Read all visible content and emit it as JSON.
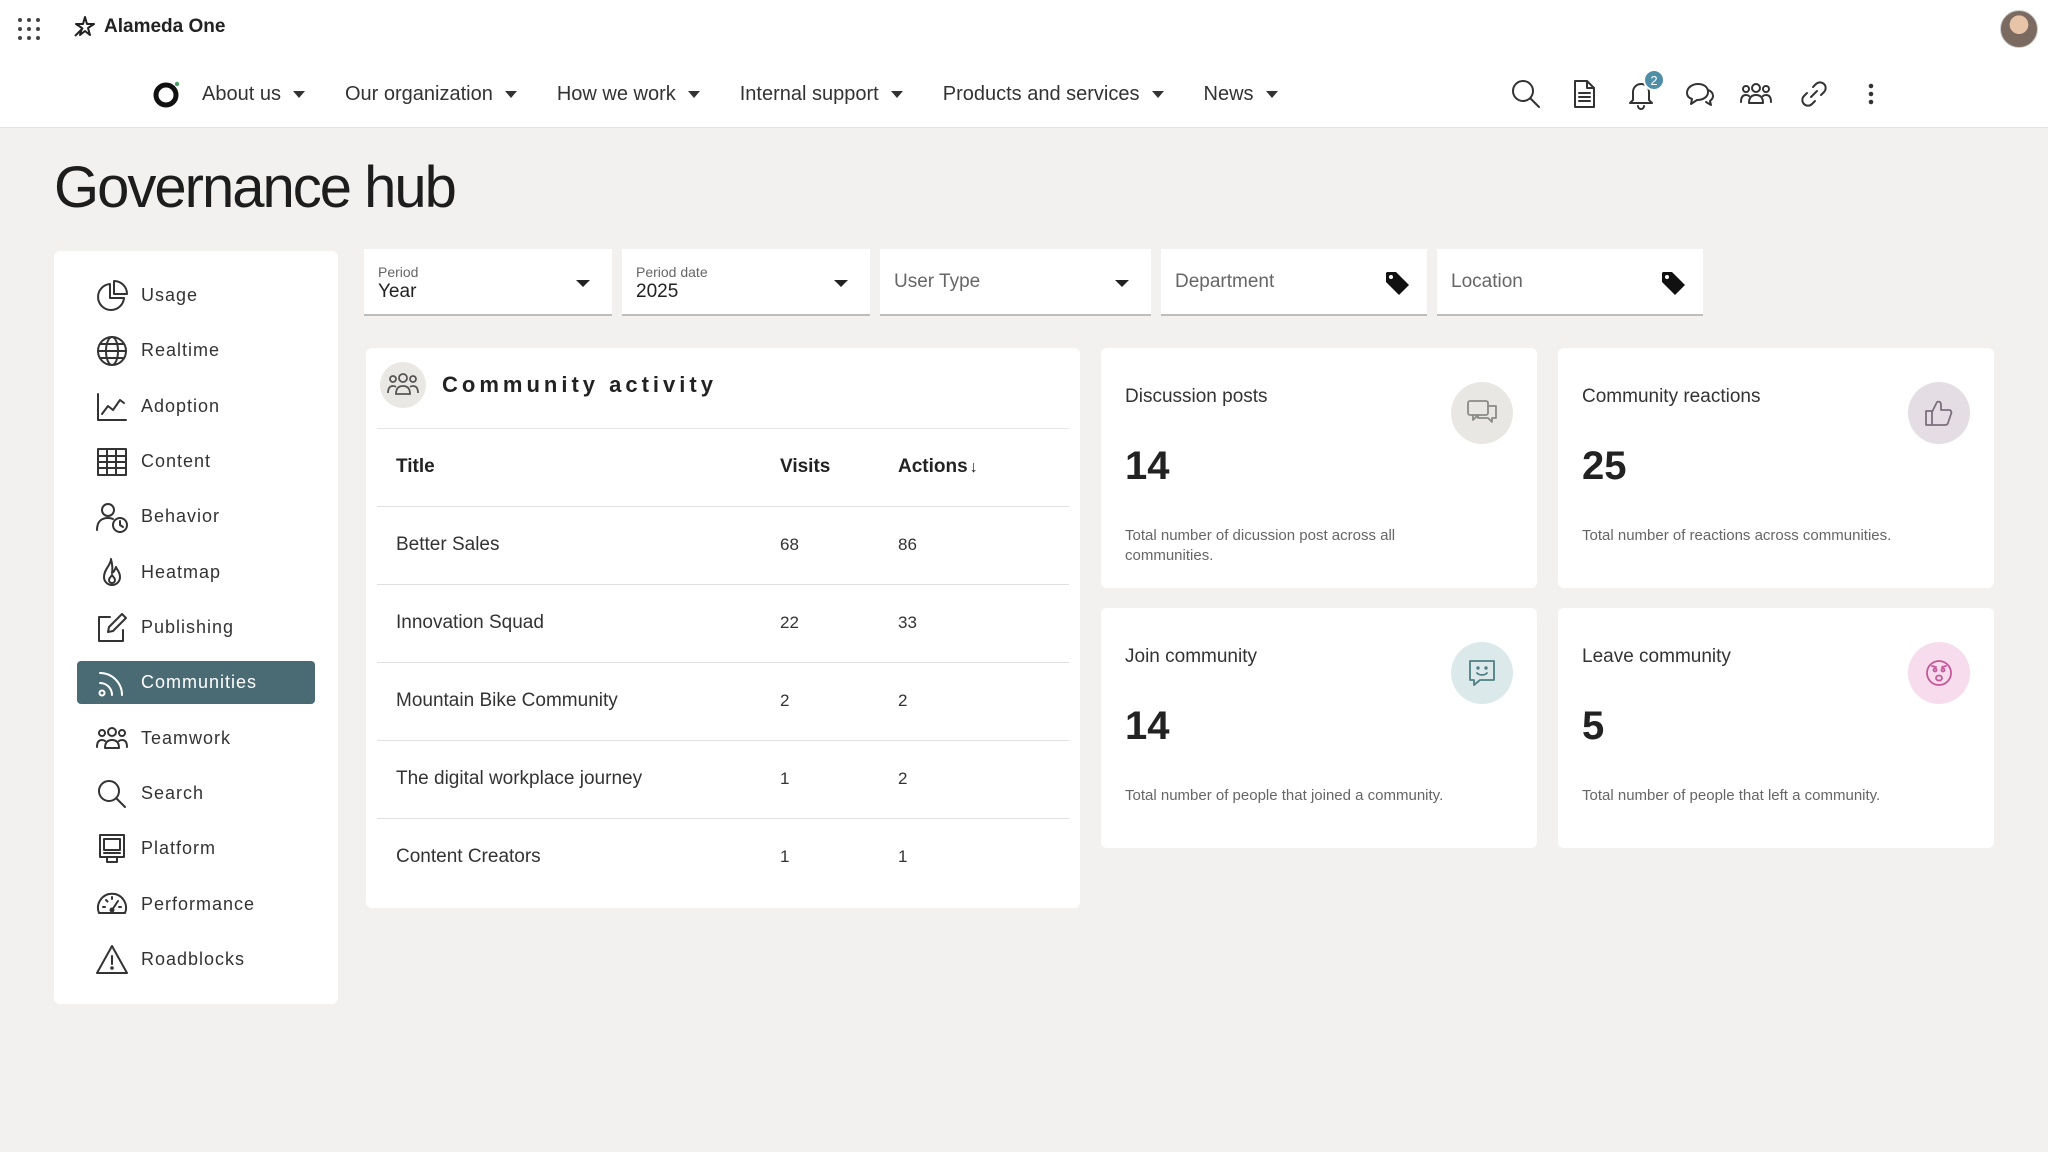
{
  "app": {
    "name": "Alameda One"
  },
  "nav": {
    "items": [
      {
        "label": "About us"
      },
      {
        "label": "Our organization"
      },
      {
        "label": "How we work"
      },
      {
        "label": "Internal support"
      },
      {
        "label": "Products and services"
      },
      {
        "label": "News"
      }
    ]
  },
  "tools": {
    "notification_count": "2"
  },
  "page": {
    "title": "Governance hub"
  },
  "sidebar": {
    "items": [
      {
        "label": "Usage",
        "icon": "pie-chart-icon"
      },
      {
        "label": "Realtime",
        "icon": "globe-icon"
      },
      {
        "label": "Adoption",
        "icon": "line-chart-icon"
      },
      {
        "label": "Content",
        "icon": "table-icon"
      },
      {
        "label": "Behavior",
        "icon": "user-clock-icon"
      },
      {
        "label": "Heatmap",
        "icon": "flame-icon"
      },
      {
        "label": "Publishing",
        "icon": "edit-icon"
      },
      {
        "label": "Communities",
        "icon": "rss-icon",
        "active": true
      },
      {
        "label": "Teamwork",
        "icon": "team-icon"
      },
      {
        "label": "Search",
        "icon": "search-icon"
      },
      {
        "label": "Platform",
        "icon": "monitor-icon"
      },
      {
        "label": "Performance",
        "icon": "gauge-icon"
      },
      {
        "label": "Roadblocks",
        "icon": "warning-icon"
      }
    ]
  },
  "filters": {
    "period": {
      "label": "Period",
      "value": "Year"
    },
    "period_date": {
      "label": "Period date",
      "value": "2025"
    },
    "user_type": {
      "placeholder": "User Type"
    },
    "department": {
      "placeholder": "Department"
    },
    "location": {
      "placeholder": "Location"
    }
  },
  "community_activity": {
    "title": "Community activity",
    "columns": {
      "title": "Title",
      "visits": "Visits",
      "actions": "Actions"
    },
    "sort_indicator": "↓",
    "rows": [
      {
        "title": "Better Sales",
        "visits": "68",
        "actions": "86"
      },
      {
        "title": "Innovation Squad",
        "visits": "22",
        "actions": "33"
      },
      {
        "title": "Mountain Bike Community",
        "visits": "2",
        "actions": "2"
      },
      {
        "title": "The digital workplace journey",
        "visits": "1",
        "actions": "2"
      },
      {
        "title": "Content Creators",
        "visits": "1",
        "actions": "1"
      }
    ]
  },
  "metrics": {
    "discussion_posts": {
      "title": "Discussion posts",
      "value": "14",
      "description": "Total number of dicussion post across all communities.",
      "icon": "chat-bubbles-icon",
      "icon_bg": "#e8e7e3"
    },
    "community_reactions": {
      "title": "Community reactions",
      "value": "25",
      "description": "Total number of reactions across communities.",
      "icon": "thumbs-up-icon",
      "icon_bg": "#e4dee4"
    },
    "join_community": {
      "title": "Join community",
      "value": "14",
      "description": "Total number of people that joined a community.",
      "icon": "smile-chat-icon",
      "icon_bg": "#dbe9ea"
    },
    "leave_community": {
      "title": "Leave community",
      "value": "5",
      "description": "Total number of people that left a community.",
      "icon": "sad-face-icon",
      "icon_bg": "#f6dcec"
    }
  }
}
